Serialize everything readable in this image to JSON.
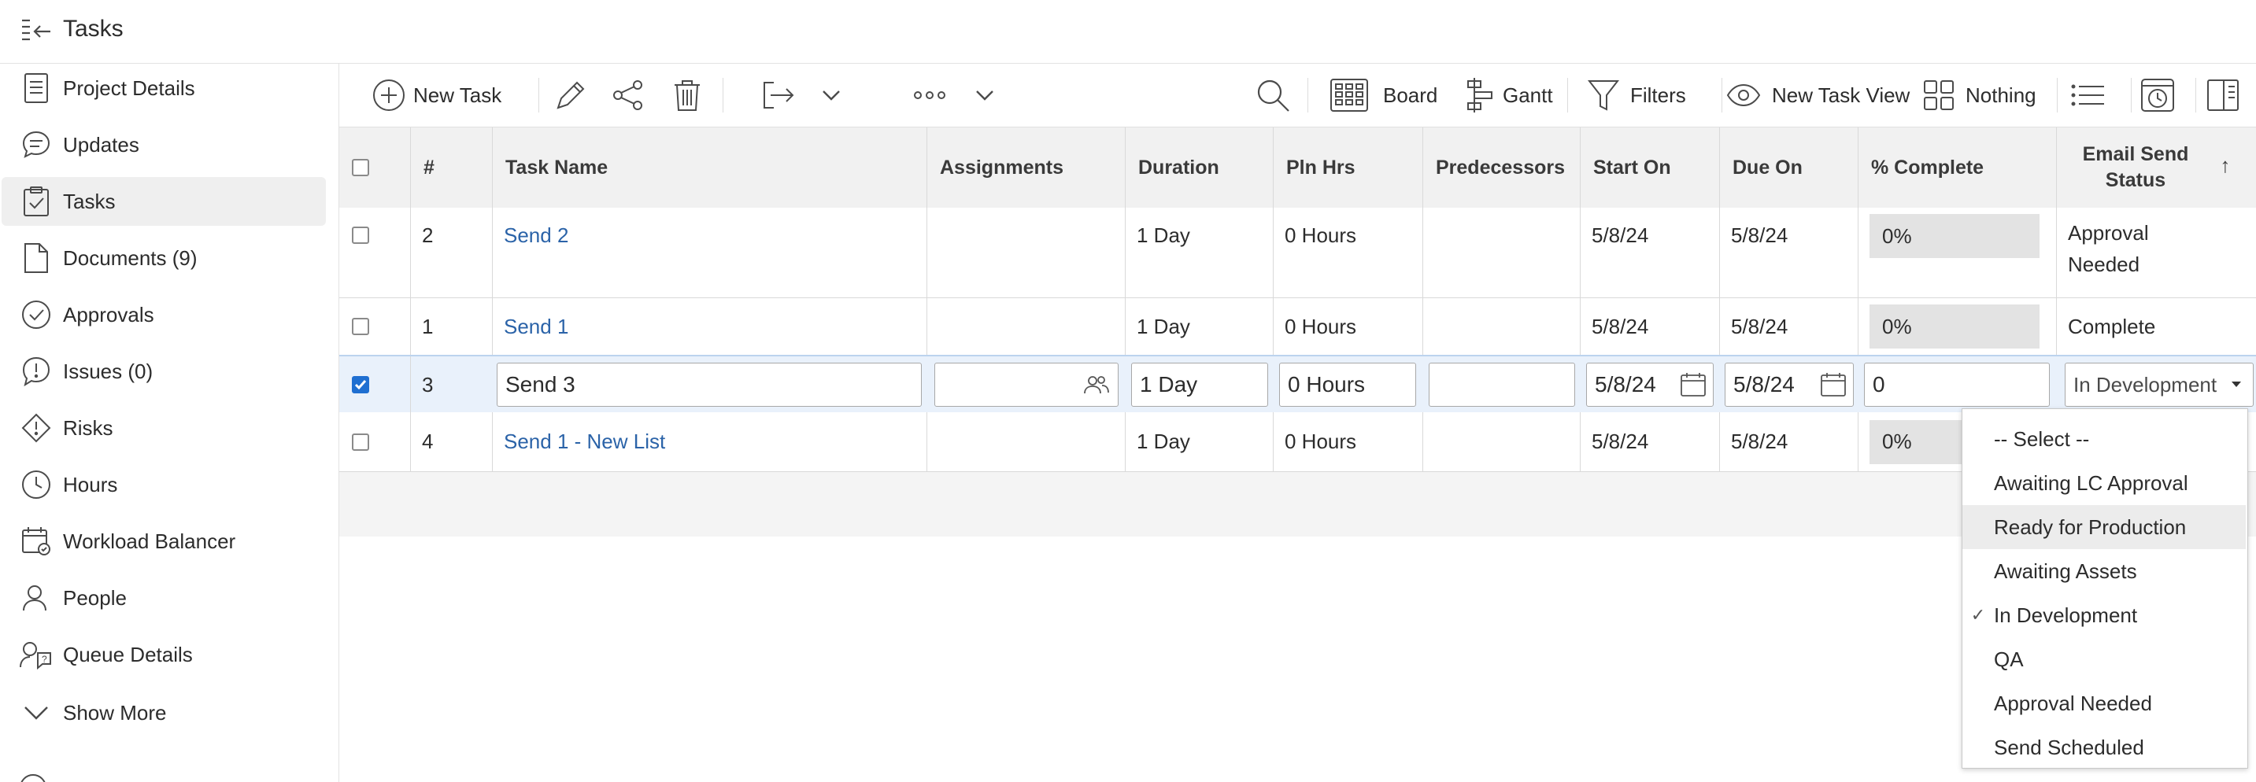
{
  "header": {
    "title": "Tasks"
  },
  "sidebar": {
    "items": [
      {
        "label": "Project Details"
      },
      {
        "label": "Updates"
      },
      {
        "label": "Tasks"
      },
      {
        "label": "Documents (9)"
      },
      {
        "label": "Approvals"
      },
      {
        "label": "Issues (0)"
      },
      {
        "label": "Risks"
      },
      {
        "label": "Hours"
      },
      {
        "label": "Workload Balancer"
      },
      {
        "label": "People"
      },
      {
        "label": "Queue Details"
      },
      {
        "label": "Show More"
      }
    ]
  },
  "toolbar": {
    "new_task": "New Task",
    "board": "Board",
    "gantt": "Gantt",
    "filters": "Filters",
    "new_task_view": "New Task View",
    "nothing": "Nothing"
  },
  "table": {
    "columns": [
      "#",
      "Task Name",
      "Assignments",
      "Duration",
      "Pln Hrs",
      "Predecessors",
      "Start On",
      "Due On",
      "% Complete",
      "Email Send",
      "Status"
    ],
    "sort_icon": "↑",
    "rows": [
      {
        "num": "2",
        "name": "Send 2",
        "duration": "1 Day",
        "pln_hrs": "0 Hours",
        "start": "5/8/24",
        "due": "5/8/24",
        "pct": "0%",
        "status": "Approval Needed"
      },
      {
        "num": "1",
        "name": "Send 1",
        "duration": "1 Day",
        "pln_hrs": "0 Hours",
        "start": "5/8/24",
        "due": "5/8/24",
        "pct": "0%",
        "status": "Complete"
      },
      {
        "num": "3",
        "name": "Send 3",
        "duration": "1 Day",
        "pln_hrs": "0 Hours",
        "start": "5/8/24",
        "due": "5/8/24",
        "pct": "0",
        "status": "In Development"
      },
      {
        "num": "4",
        "name": "Send 1 - New List",
        "duration": "1 Day",
        "pln_hrs": "0 Hours",
        "start": "5/8/24",
        "due": "5/8/24",
        "pct": "0%",
        "status": ""
      }
    ]
  },
  "dropdown": {
    "options": [
      "-- Select --",
      "Awaiting LC Approval",
      "Ready for Production",
      "Awaiting Assets",
      "In Development",
      "QA",
      "Approval Needed",
      "Send Scheduled"
    ],
    "selected": "In Development",
    "check": "✓"
  }
}
